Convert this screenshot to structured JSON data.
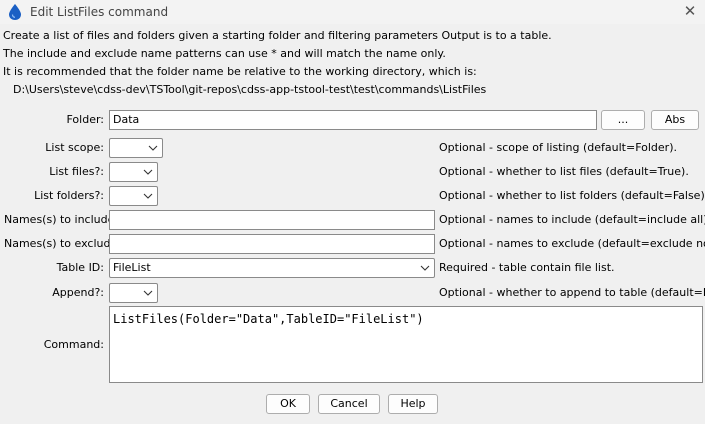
{
  "window": {
    "title": "Edit ListFiles command",
    "close_glyph": "✕"
  },
  "description": {
    "line1": "Create a list of files and folders given a starting folder and filtering parameters  Output is to a table.",
    "line2": "The include and exclude name patterns can use * and will match the name only.",
    "line3": "It is recommended that the folder name be relative to the working directory, which is:",
    "working_dir": "D:\\Users\\steve\\cdss-dev\\TSTool\\git-repos\\cdss-app-tstool-test\\test\\commands\\ListFiles"
  },
  "form": {
    "folder": {
      "label": "Folder:",
      "value": "Data",
      "browse_label": "...",
      "abs_label": "Abs"
    },
    "list_scope": {
      "label": "List scope:",
      "value": "",
      "note": "Optional - scope of listing (default=Folder)."
    },
    "list_files": {
      "label": "List files?:",
      "value": "",
      "note": "Optional - whether to list files (default=True)."
    },
    "list_folders": {
      "label": "List folders?:",
      "value": "",
      "note": "Optional - whether to list folders (default=False)."
    },
    "include": {
      "label": "Names(s) to include:",
      "value": "",
      "note": "Optional - names to include (default=include all)."
    },
    "exclude": {
      "label": "Names(s) to exclude:",
      "value": "",
      "note": "Optional - names to exclude (default=exclude none)."
    },
    "table_id": {
      "label": "Table ID:",
      "value": "FileList",
      "note": "Required - table contain file list."
    },
    "append": {
      "label": "Append?:",
      "value": "",
      "note": "Optional - whether to append to table (default=False)."
    },
    "command": {
      "label": "Command:",
      "value": "ListFiles(Folder=\"Data\",TableID=\"FileList\")"
    }
  },
  "buttons": {
    "ok": "OK",
    "cancel": "Cancel",
    "help": "Help"
  },
  "colors": {
    "icon_blue": "#1a5fc4",
    "chrome": "#f0f0f0"
  }
}
